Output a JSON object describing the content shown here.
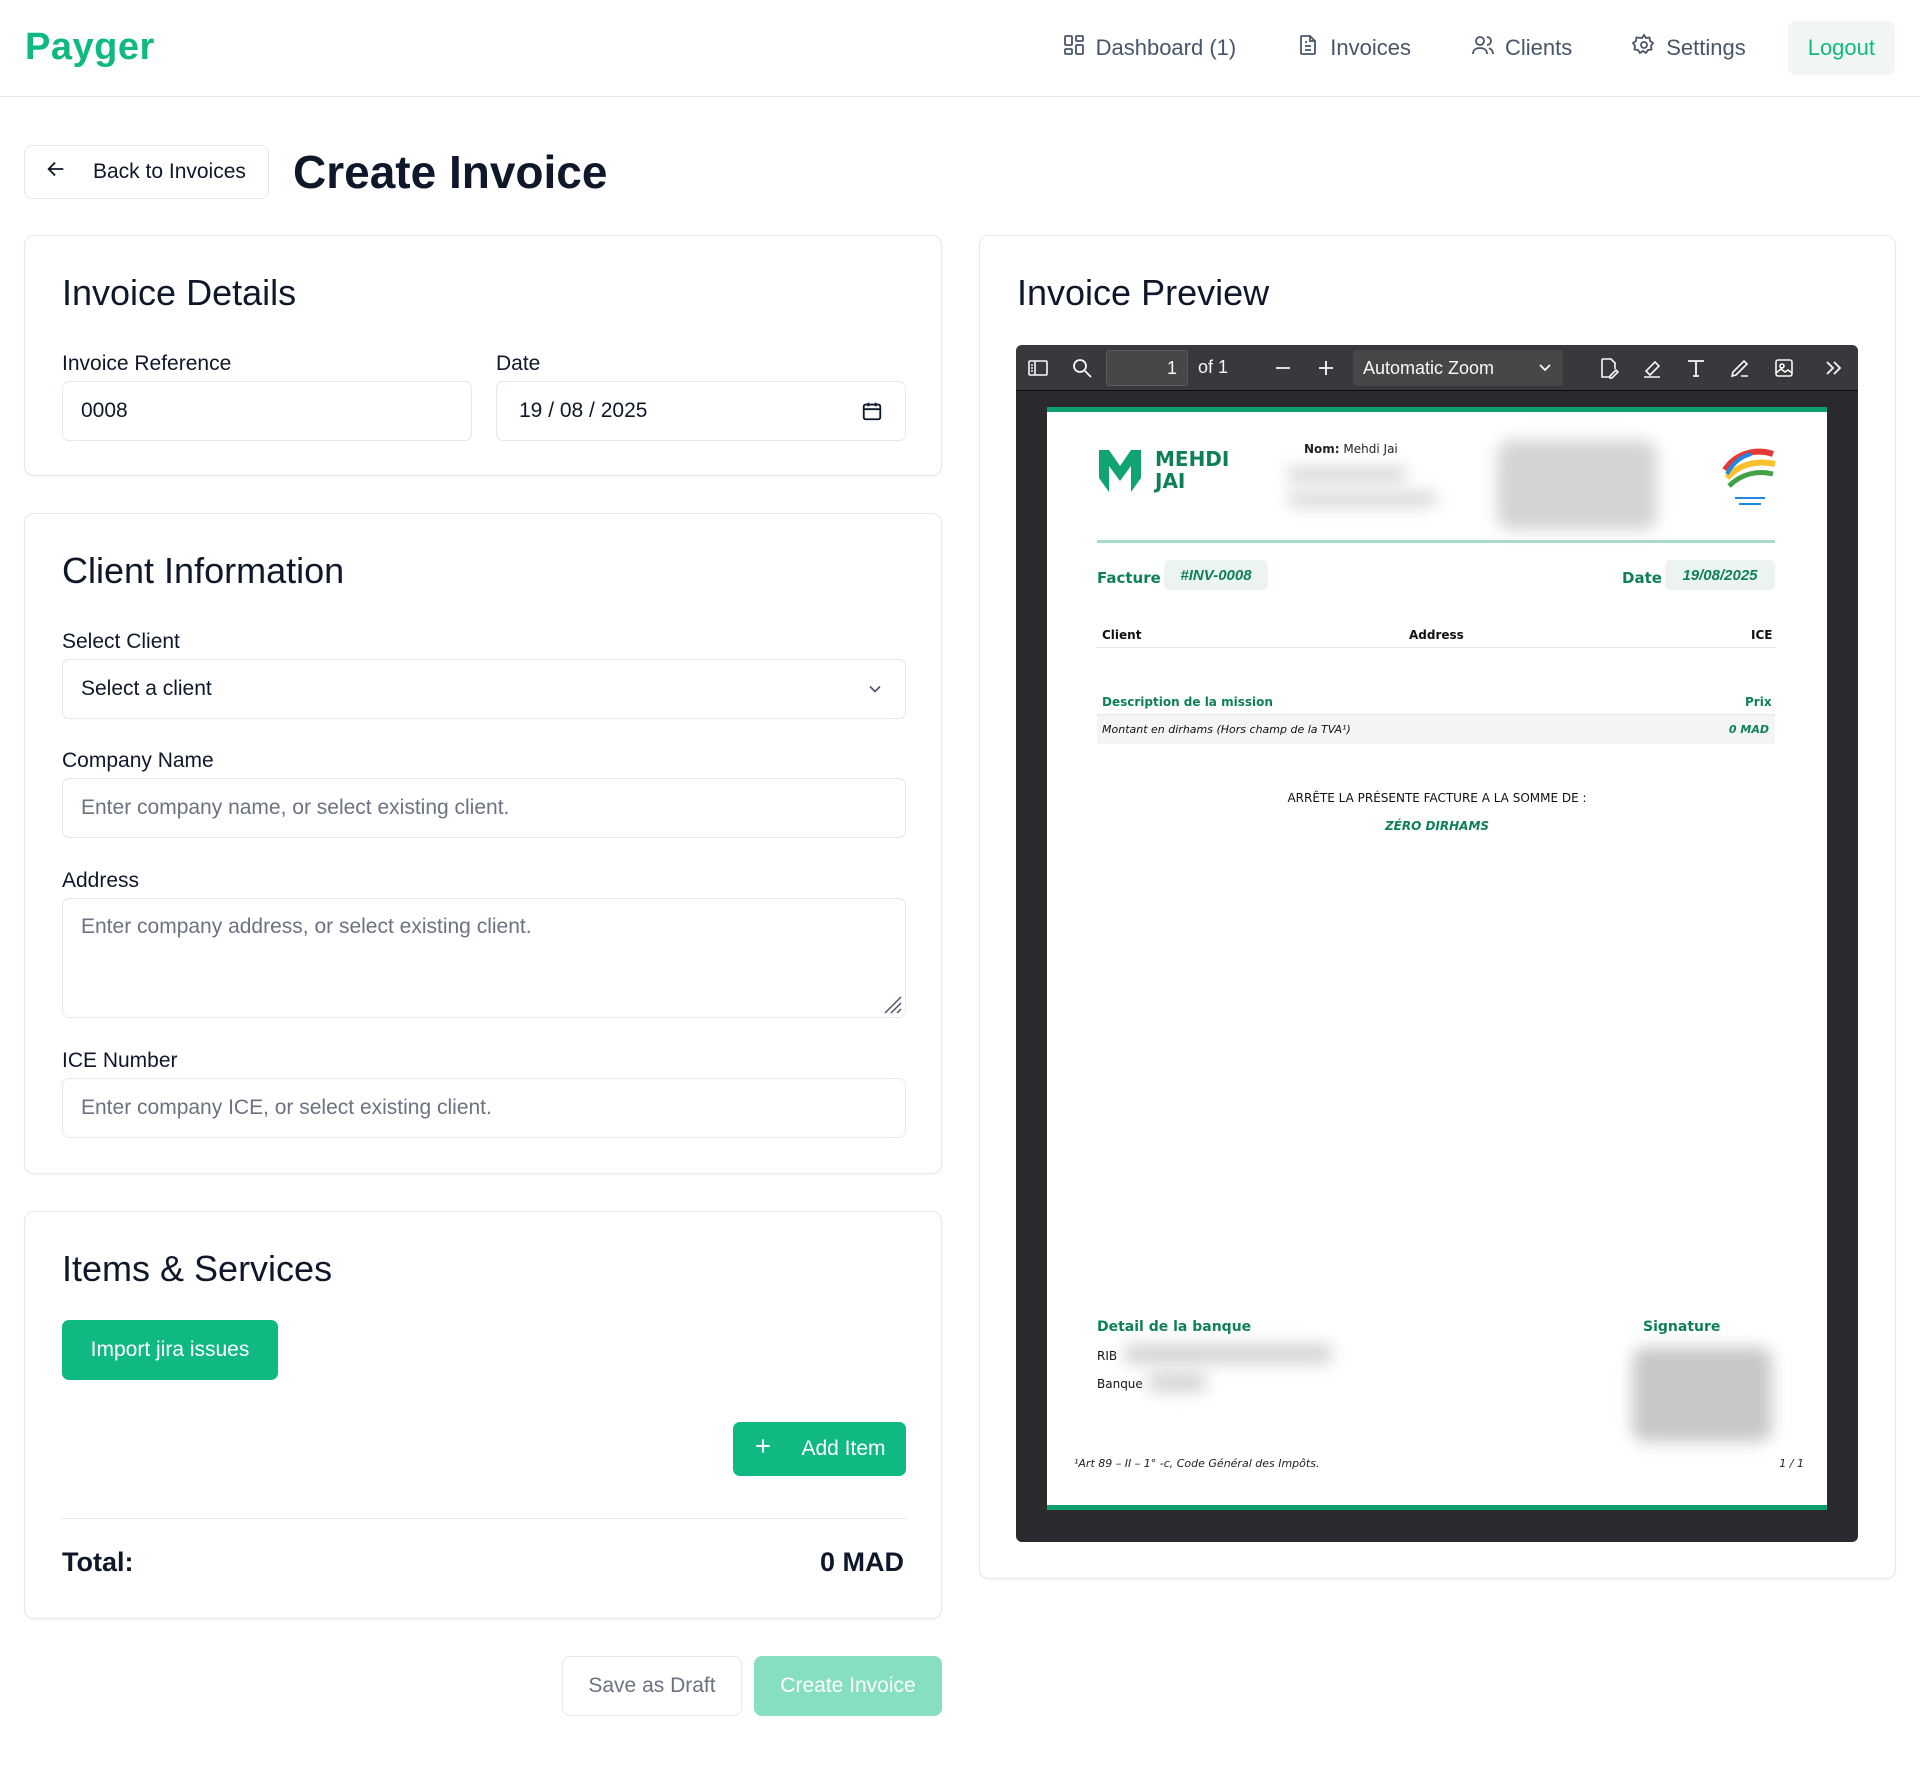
{
  "app": {
    "brand": "Payger"
  },
  "nav": {
    "dashboard": "Dashboard (1)",
    "invoices": "Invoices",
    "clients": "Clients",
    "settings": "Settings",
    "logout": "Logout"
  },
  "page": {
    "back_label": "Back to Invoices",
    "title": "Create Invoice"
  },
  "invoice_details": {
    "title": "Invoice Details",
    "reference_label": "Invoice Reference",
    "reference_value": "0008",
    "date_label": "Date",
    "date_value": "19 / 08 / 2025"
  },
  "client_info": {
    "title": "Client Information",
    "select_label": "Select Client",
    "select_value": "Select a client",
    "company_label": "Company Name",
    "company_placeholder": "Enter company name, or select existing client.",
    "address_label": "Address",
    "address_placeholder": "Enter company address, or select existing client.",
    "ice_label": "ICE Number",
    "ice_placeholder": "Enter company ICE, or select existing client."
  },
  "items": {
    "title": "Items & Services",
    "import_label": "Import jira issues",
    "add_label": "Add Item",
    "total_label": "Total:",
    "total_value": "0 MAD"
  },
  "actions": {
    "save_draft": "Save as Draft",
    "create": "Create Invoice"
  },
  "preview": {
    "title": "Invoice Preview",
    "toolbar": {
      "page_number": "1",
      "page_total": "of 1",
      "zoom": "Automatic Zoom"
    },
    "document": {
      "logo_line1": "MEHDI",
      "logo_line2": "JAI",
      "nom_label": "Nom:",
      "nom_value": "Mehdi Jai",
      "facture_label": "Facture",
      "facture_number": "#INV-0008",
      "date_label": "Date",
      "date_value": "19/08/2025",
      "client_col": "Client",
      "address_col": "Address",
      "ice_col": "ICE",
      "desc_header": "Description de la mission",
      "price_header": "Prix",
      "amount_line": "Montant en dirhams (Hors champ de la TVA¹)",
      "amount_value": "0 MAD",
      "arrete_text": "ARRÊTE LA PRÉSENTE FACTURE A LA SOMME DE :",
      "amount_words": "ZÉRO DIRHAMS",
      "bank_title": "Detail de la banque",
      "rib_label": "RIB",
      "banque_label": "Banque",
      "signature_title": "Signature",
      "footnote": "¹Art 89 – II – 1° -c, Code Général des Impôts.",
      "page_counter": "1 / 1"
    }
  },
  "colors": {
    "accent": "#10b981",
    "doc_green": "#0f7f5a",
    "viewer_bg": "#2a2a2e"
  },
  "icons": [
    "dashboard-icon",
    "document-icon",
    "users-icon",
    "gear-icon",
    "arrow-left-icon",
    "calendar-icon",
    "chevron-down-icon",
    "plus-icon"
  ]
}
